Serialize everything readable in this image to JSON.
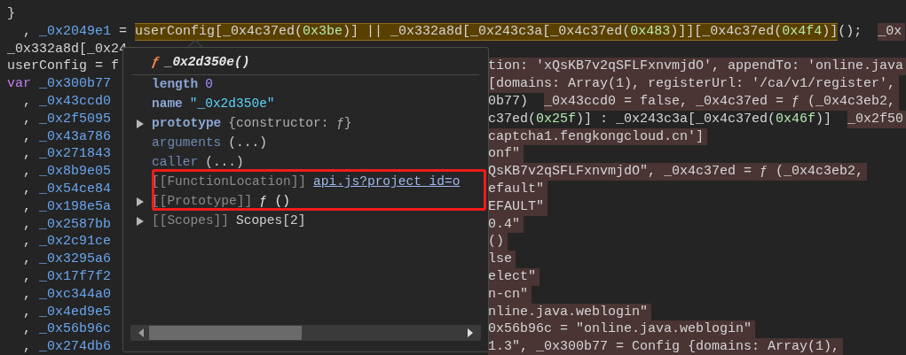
{
  "code_lines": [
    {
      "segments": [
        {
          "text": "}",
          "kind": "plain"
        }
      ]
    },
    {
      "segments": [
        {
          "text": "  , ",
          "kind": "plain"
        },
        {
          "text": "_0x2049e1",
          "kind": "decl"
        },
        {
          "text": " = ",
          "kind": "plain"
        },
        {
          "text": "userConfig[_0x4c37ed(",
          "kind": "plain",
          "matched": true
        },
        {
          "text": "0x3be",
          "kind": "number",
          "matched": true
        },
        {
          "text": ")] || _0x332a8d[_0x243c3a[_0x4c37ed(",
          "kind": "plain",
          "matched": true
        },
        {
          "text": "0x483",
          "kind": "number",
          "matched": true
        },
        {
          "text": ")]][_0x4c37ed(",
          "kind": "plain",
          "matched": true
        },
        {
          "text": "0x4f4",
          "kind": "number",
          "matched": true
        },
        {
          "text": ")]",
          "kind": "plain",
          "matched": true
        },
        {
          "text": "();  ",
          "kind": "plain"
        },
        {
          "text": "_0x",
          "kind": "value"
        }
      ]
    },
    {
      "segments": [
        {
          "text": "_0x332a8d[_0x24",
          "kind": "plain"
        }
      ]
    },
    {
      "left": [
        {
          "text": "userConfig = f",
          "kind": "plain"
        }
      ],
      "right": [
        {
          "text": "tion: 'xQsKB7v2qSFLFxnvmjdO', appendTo: 'online.java",
          "kind": "value"
        }
      ]
    },
    {
      "left": [
        {
          "text": "var ",
          "kind": "keyword"
        },
        {
          "text": "_0x300b77",
          "kind": "decl"
        }
      ],
      "right": [
        {
          "text": "[domains: Array(1), registerUrl: '/ca/v1/register',",
          "kind": "value"
        }
      ]
    },
    {
      "left": [
        {
          "text": "  , ",
          "kind": "plain"
        },
        {
          "text": "_0x43ccd0",
          "kind": "decl"
        }
      ],
      "right": [
        {
          "text": "0b77)  ",
          "kind": "plain"
        },
        {
          "text": "_0x43ccd0 = false, _0x4c37ed = ƒ (_0x4c3eb2,",
          "kind": "value"
        }
      ]
    },
    {
      "left": [
        {
          "text": "  , ",
          "kind": "plain"
        },
        {
          "text": "_0x2f5095",
          "kind": "decl"
        }
      ],
      "right": [
        {
          "text": "c37ed(",
          "kind": "plain"
        },
        {
          "text": "0x25f",
          "kind": "number"
        },
        {
          "text": ")] : _0x243c3a[_0x4c37ed(",
          "kind": "plain"
        },
        {
          "text": "0x46f",
          "kind": "number"
        },
        {
          "text": ")]  ",
          "kind": "plain"
        },
        {
          "text": "_0x2f50",
          "kind": "value"
        }
      ]
    },
    {
      "left": [
        {
          "text": "  , ",
          "kind": "plain"
        },
        {
          "text": "_0x43a786",
          "kind": "decl"
        }
      ],
      "right": [
        {
          "text": "captcha1.fengkongcloud.cn']",
          "kind": "value"
        }
      ]
    },
    {
      "left": [
        {
          "text": "  , ",
          "kind": "plain"
        },
        {
          "text": "_0x271843",
          "kind": "decl"
        }
      ],
      "right": [
        {
          "text": "onf\"",
          "kind": "value"
        }
      ]
    },
    {
      "left": [
        {
          "text": "  , ",
          "kind": "plain"
        },
        {
          "text": "_0x8b9e05",
          "kind": "decl"
        }
      ],
      "right": [
        {
          "text": "QsKB7v2qSFLFxnvmjdO\", _0x4c37ed = ƒ (_0x4c3eb2,",
          "kind": "value"
        }
      ]
    },
    {
      "left": [
        {
          "text": "  , ",
          "kind": "plain"
        },
        {
          "text": "_0x54ce84",
          "kind": "decl"
        }
      ],
      "right": [
        {
          "text": "efault\"",
          "kind": "value"
        }
      ]
    },
    {
      "left": [
        {
          "text": "  , ",
          "kind": "plain"
        },
        {
          "text": "_0x198e5a",
          "kind": "decl"
        }
      ],
      "right": [
        {
          "text": "EFAULT\"",
          "kind": "value"
        }
      ]
    },
    {
      "left": [
        {
          "text": "  , ",
          "kind": "plain"
        },
        {
          "text": "_0x2587bb",
          "kind": "decl"
        }
      ],
      "right": [
        {
          "text": "0.4\"",
          "kind": "value"
        }
      ]
    },
    {
      "left": [
        {
          "text": "  , ",
          "kind": "plain"
        },
        {
          "text": "_0x2c91ce",
          "kind": "decl"
        }
      ],
      "right": [
        {
          "text": "()",
          "kind": "value"
        }
      ]
    },
    {
      "left": [
        {
          "text": "  , ",
          "kind": "plain"
        },
        {
          "text": "_0x3295a6",
          "kind": "decl"
        }
      ],
      "right": [
        {
          "text": "lse",
          "kind": "value"
        }
      ]
    },
    {
      "left": [
        {
          "text": "  , ",
          "kind": "plain"
        },
        {
          "text": "_0x17f7f2",
          "kind": "decl"
        }
      ],
      "right": [
        {
          "text": "elect\"",
          "kind": "value"
        }
      ]
    },
    {
      "left": [
        {
          "text": "  , ",
          "kind": "plain"
        },
        {
          "text": "_0xc344a0",
          "kind": "decl"
        }
      ],
      "right": [
        {
          "text": "n-cn\"",
          "kind": "value"
        }
      ]
    },
    {
      "left": [
        {
          "text": "  , ",
          "kind": "plain"
        },
        {
          "text": "_0x4ed9e5",
          "kind": "decl"
        }
      ],
      "right": [
        {
          "text": "nline.java.weblogin\"",
          "kind": "value"
        }
      ]
    },
    {
      "left": [
        {
          "text": "  , ",
          "kind": "plain"
        },
        {
          "text": "_0x56b96c",
          "kind": "decl"
        }
      ],
      "right": [
        {
          "text": "0x56b96c = \"online.java.weblogin\"",
          "kind": "value"
        }
      ]
    },
    {
      "left": [
        {
          "text": "  , ",
          "kind": "plain"
        },
        {
          "text": "_0x274db6",
          "kind": "decl"
        }
      ],
      "right": [
        {
          "text": "1.3\", _0x300b77 = Config {domains: Array(1),",
          "kind": "value"
        }
      ]
    }
  ],
  "popover": {
    "glyph": "ƒ",
    "title": "_0x2d350e()",
    "properties": [
      {
        "key": {
          "text": "length",
          "kind": "own"
        },
        "expandable": false,
        "value": {
          "text": "0",
          "kind": "number"
        }
      },
      {
        "key": {
          "text": "name",
          "kind": "own"
        },
        "expandable": false,
        "value": {
          "text": "\"_0x2d350e\"",
          "kind": "string"
        }
      },
      {
        "key": {
          "text": "prototype",
          "kind": "own"
        },
        "expandable": true,
        "value": {
          "text": "{constructor: ƒ}",
          "kind": "object"
        }
      },
      {
        "key": {
          "text": "arguments",
          "kind": "accessor"
        },
        "expandable": false,
        "value": {
          "text": "(...)",
          "kind": "plain"
        }
      },
      {
        "key": {
          "text": "caller",
          "kind": "accessor"
        },
        "expandable": false,
        "value": {
          "text": "(...)",
          "kind": "plain"
        }
      },
      {
        "key": {
          "text": "[[FunctionLocation]]",
          "kind": "internal"
        },
        "expandable": false,
        "value": {
          "text": "api.js?project_id=o",
          "kind": "link"
        }
      },
      {
        "key": {
          "text": "[[Prototype]]",
          "kind": "internal"
        },
        "expandable": true,
        "value": {
          "text": "ƒ ()",
          "kind": "function"
        }
      },
      {
        "key": {
          "text": "[[Scopes]]",
          "kind": "internal"
        },
        "expandable": true,
        "value": {
          "text": "Scopes[2]",
          "kind": "plain"
        }
      }
    ]
  }
}
